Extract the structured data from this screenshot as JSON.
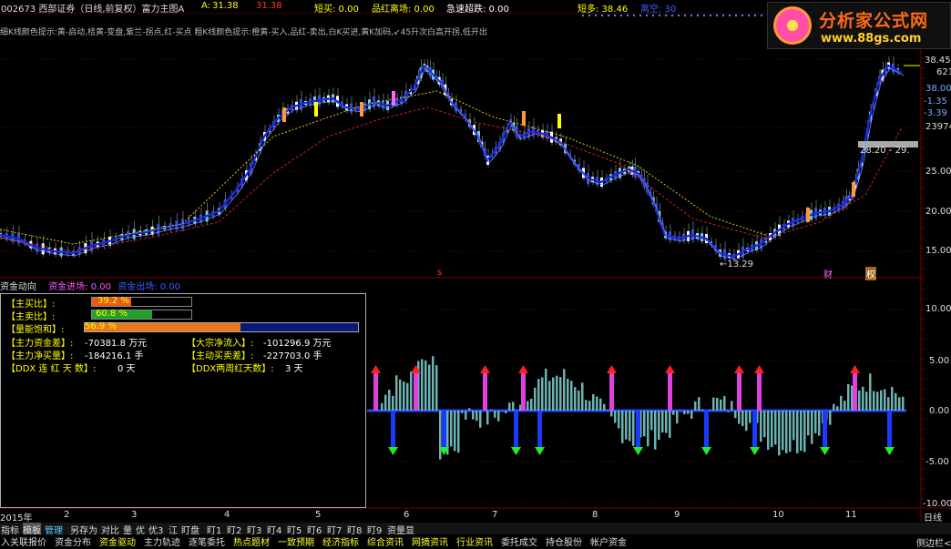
{
  "header": {
    "stock": "002673 西部证券（日线,前复权）富力主图A",
    "indicator_a_label": "A: ",
    "indicator_a_value": "31.38",
    "indicator_b_value": "31.38",
    "short_buy": "短买: 0.00",
    "pinhong": "品红离场: 0.00",
    "rapid_drop": "急速超跌: 0.00",
    "short_long": "短多: 38.46",
    "exit_short": "离空: 30"
  },
  "hint_text": "细K线颜色提示:黄-启动,桔黄-变盘,紫兰-拐点,红-买点 粗K线颜色提示:橙黄-买入,品红-卖出,白K买进,黄K加码,↙45升次白高开拐,低开出",
  "logo": {
    "title": "分析家公式网",
    "url": "www.88gs.com"
  },
  "price_axis": {
    "labels": [
      "38.45",
      "621",
      "38.00",
      "-1.35",
      "-3.39",
      "23974",
      "25.00",
      "20.00",
      "15.00"
    ],
    "box_text": "28.20 - 29."
  },
  "chart_annotations": {
    "low_label": "←13.29",
    "marker_cai": "财",
    "marker_quan": "权",
    "marker_s": "s"
  },
  "fund": {
    "title": "资金动向",
    "enter_label": "资金进场: 0.00",
    "exit_label": "资金出场: 0.00",
    "panel": {
      "main_buy_label": "【主买比】:",
      "main_buy_value": "39.2 %",
      "main_buy_pct": 39.2,
      "main_sell_label": "【主卖比】:",
      "main_sell_value": "60.8 %",
      "main_sell_pct": 60.8,
      "saturation_label": "【量能饱和】:",
      "saturation_value": "56.9 %",
      "saturation_pct": 56.9,
      "net_capital_label": "【主力资金差】:",
      "net_capital_value": "-70381.8 万元",
      "big_inflow_label": "【大宗净流入】:",
      "big_inflow_value": "-101296.9 万元",
      "net_buy_label": "【主力净买量】:",
      "net_buy_value": "-184216.1 手",
      "active_diff_label": "【主动买卖差】:",
      "active_diff_value": "-227703.0 手",
      "ddx_red_label": "【DDX 连 红 天 数】:",
      "ddx_red_value": "0 天",
      "ddx_2w_label": "【DDX两周红天数】:",
      "ddx_2w_value": "3 天"
    },
    "axis": [
      "10.00",
      "5.00",
      "0.00",
      "-5.00",
      "-10.00"
    ]
  },
  "timeline": {
    "year": "2015年",
    "months": [
      "2",
      "3",
      "4",
      "5",
      "6",
      "7",
      "8",
      "9",
      "10",
      "11"
    ],
    "period": "日线"
  },
  "menu1": [
    "指标",
    "模板",
    "管理",
    "另存为",
    "对比",
    "量",
    "优",
    "优3",
    "江",
    "盯盘",
    "盯1",
    "盯2",
    "盯3",
    "盯4",
    "盯5",
    "盯6",
    "盯7",
    "盯8",
    "盯9",
    "资量显"
  ],
  "menu2": [
    "入",
    "关联报价",
    "资金分布",
    "资金驱动",
    "主力轨迹",
    "逐笔委托",
    "热点题材",
    "一致预期",
    "经济指标",
    "综合资讯",
    "网摘资讯",
    "行业资讯",
    "委托成交",
    "持仓股份",
    "帐户资金"
  ],
  "menu2_right": "侧边栏<<",
  "colors": {
    "yellow": "#ffff00",
    "pink": "#ff55ff",
    "red": "#ff3030",
    "blue": "#3050ff",
    "cyan": "#6bb3b3",
    "grid": "#7a0000"
  }
}
